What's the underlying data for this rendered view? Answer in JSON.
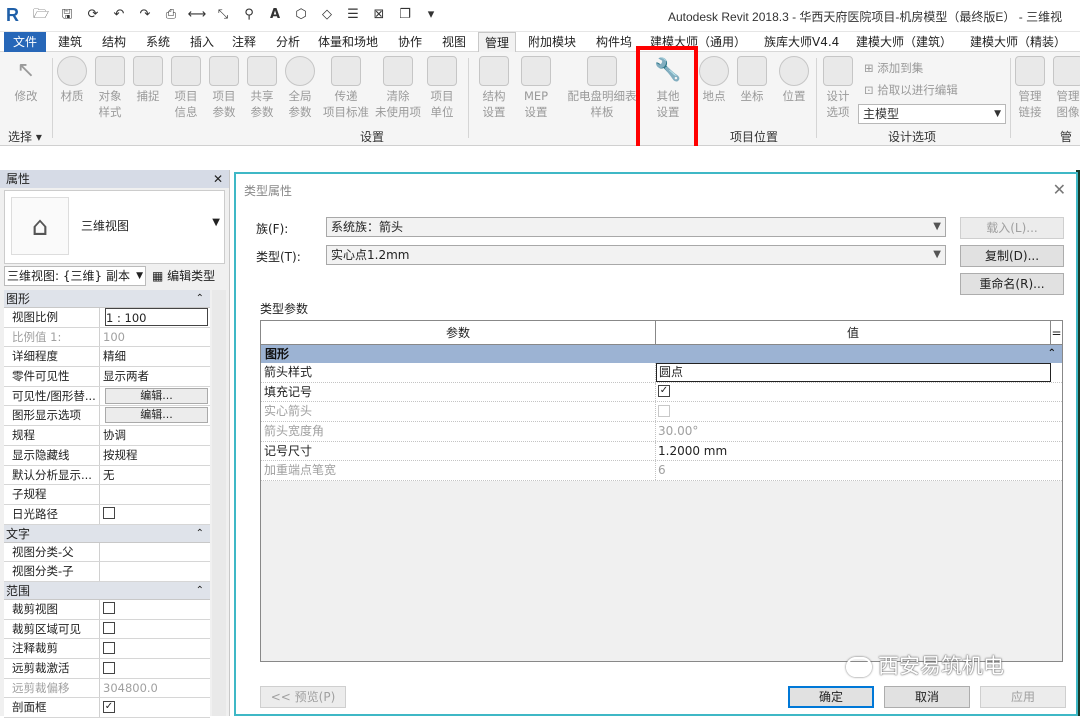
{
  "titlebar": {
    "title": "Autodesk Revit 2018.3 -    华西天府医院项目-机房模型（最终版E） - 三维视",
    "qat_icons": [
      "open-icon",
      "save-icon",
      "sync-icon",
      "undo-icon",
      "redo-icon",
      "print-icon",
      "measure-icon",
      "dimension-icon",
      "tag-icon",
      "text-icon",
      "3d-view-icon",
      "section-icon",
      "thin-lines-icon",
      "close-hidden-icon",
      "switch-windows-icon",
      "customize-icon"
    ]
  },
  "menu": {
    "file": "文件",
    "tabs": [
      "建筑",
      "结构",
      "系统",
      "插入",
      "注释",
      "分析",
      "体量和场地",
      "协作",
      "视图",
      "管理",
      "附加模块",
      "构件坞",
      "建模大师（通用）",
      "族库大师V4.4",
      "建模大师（建筑）",
      "建模大师（精装）"
    ],
    "active": "管理"
  },
  "ribbon": {
    "modify": "修改",
    "select": "选择 ▾",
    "settings_panel": "设置",
    "location_panel": "项目位置",
    "design_panel": "设计选项",
    "manage_panel": "管理",
    "buttons": {
      "materials": "材质",
      "object_styles": [
        "对象",
        "样式"
      ],
      "snaps": "捕捉",
      "project_info": [
        "项目",
        "信息"
      ],
      "project_params": [
        "项目",
        "参数"
      ],
      "shared_params": [
        "共享",
        "参数"
      ],
      "global_params": [
        "全局",
        "参数"
      ],
      "transfer_standards": [
        "传递",
        "项目标准"
      ],
      "purge_unused": [
        "清除",
        "未使用项"
      ],
      "project_units": [
        "项目",
        "单位"
      ],
      "structural_settings": [
        "结构",
        "设置"
      ],
      "mep_settings": [
        "MEP",
        "设置"
      ],
      "panel_schedule": [
        "配电盘明细表",
        "样板"
      ],
      "additional_settings": [
        "其他",
        "设置"
      ],
      "location": "地点",
      "coordinates": "坐标",
      "position": "位置",
      "design_options": [
        "设计",
        "选项"
      ],
      "manage_links": [
        "管理",
        "链接"
      ],
      "manage_images": [
        "管理",
        "图像"
      ]
    },
    "add_to_set": "添加到集",
    "pick_to_edit": "拾取以进行编辑",
    "main_model": "主模型"
  },
  "properties": {
    "title": "属性",
    "close": "✕",
    "type_name": "三维视图",
    "instance_selector": "三维视图: {三维} 副本",
    "edit_type": "编辑类型",
    "sections": [
      {
        "name": "图形",
        "rows": [
          {
            "k": "视图比例",
            "v": "1 : 100",
            "style": "box"
          },
          {
            "k": "比例值 1:",
            "v": "100",
            "dis": true
          },
          {
            "k": "详细程度",
            "v": "精细"
          },
          {
            "k": "零件可见性",
            "v": "显示两者"
          },
          {
            "k": "可见性/图形替...",
            "v": "编辑...",
            "style": "btn"
          },
          {
            "k": "图形显示选项",
            "v": "编辑...",
            "style": "btn"
          },
          {
            "k": "规程",
            "v": "协调"
          },
          {
            "k": "显示隐藏线",
            "v": "按规程"
          },
          {
            "k": "默认分析显示...",
            "v": "无"
          },
          {
            "k": "子规程",
            "v": ""
          },
          {
            "k": "日光路径",
            "v": "",
            "style": "cb"
          }
        ]
      },
      {
        "name": "文字",
        "rows": [
          {
            "k": "视图分类-父",
            "v": ""
          },
          {
            "k": "视图分类-子",
            "v": ""
          }
        ]
      },
      {
        "name": "范围",
        "rows": [
          {
            "k": "裁剪视图",
            "v": "",
            "style": "cb"
          },
          {
            "k": "裁剪区域可见",
            "v": "",
            "style": "cb"
          },
          {
            "k": "注释裁剪",
            "v": "",
            "style": "cb"
          },
          {
            "k": "远剪裁激活",
            "v": "",
            "style": "cb"
          },
          {
            "k": "远剪裁偏移",
            "v": "304800.0",
            "dis": true
          },
          {
            "k": "剖面框",
            "v": "",
            "style": "cbc"
          }
        ]
      }
    ]
  },
  "dialog": {
    "title": "类型属性",
    "close": "✕",
    "family_label": "族(F):",
    "family_value": "系统族：箭头",
    "type_label": "类型(T):",
    "type_value": "实心点1.2mm",
    "load_btn": "载入(L)...",
    "duplicate_btn": "复制(D)...",
    "rename_btn": "重命名(R)...",
    "type_params_label": "类型参数",
    "col_param": "参数",
    "col_value": "值",
    "col_eq": "=",
    "section": "图形",
    "rows": [
      {
        "k": "箭头样式",
        "v": "圆点",
        "style": "field"
      },
      {
        "k": "填充记号",
        "v": "✓",
        "style": "cbc"
      },
      {
        "k": "实心箭头",
        "v": "",
        "style": "cbd",
        "dis": true
      },
      {
        "k": "箭头宽度角",
        "v": "30.00°",
        "dis": true
      },
      {
        "k": "记号尺寸",
        "v": "1.2000 mm"
      },
      {
        "k": "加重端点笔宽",
        "v": "6",
        "dis": true
      }
    ],
    "preview_btn": "<< 预览(P)",
    "ok_btn": "确定",
    "cancel_btn": "取消",
    "apply_btn": "应用"
  },
  "watermark": "西安易筑机电"
}
